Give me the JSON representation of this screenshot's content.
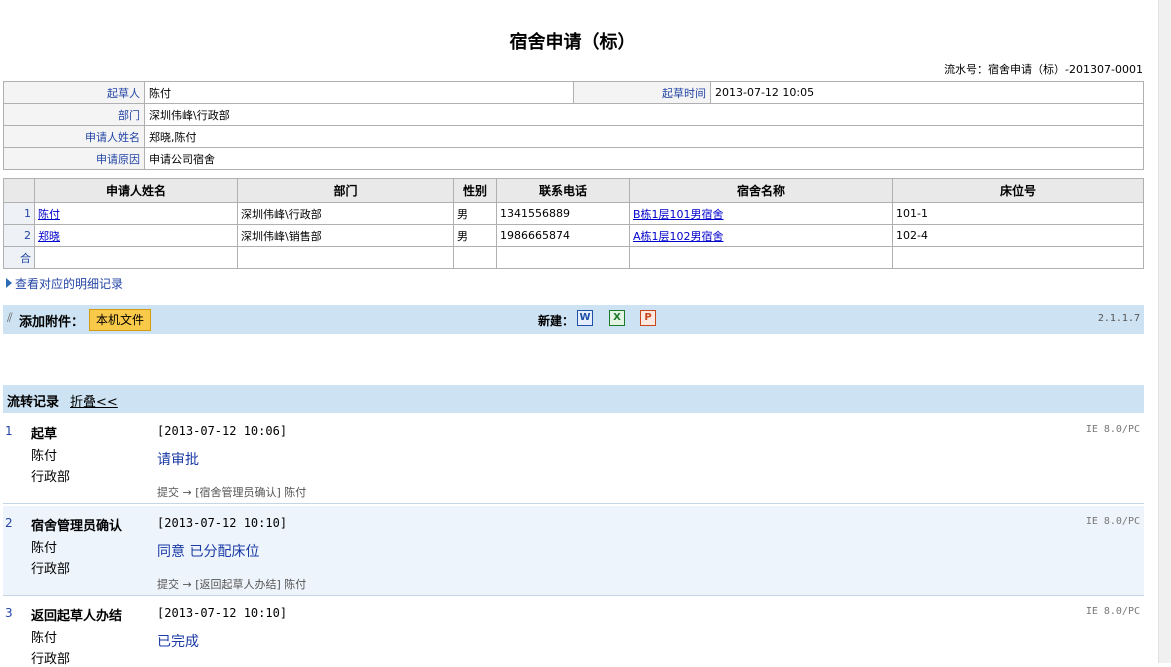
{
  "title": "宿舍申请（标）",
  "serial": "流水号：宿舍申请（标）-201307-0001",
  "info": {
    "drafter_label": "起草人",
    "drafter": "陈付",
    "draft_time_label": "起草时间",
    "draft_time": "2013-07-12 10:05",
    "dept_label": "部门",
    "dept": "深圳伟峰\\行政部",
    "applicant_label": "申请人姓名",
    "applicant": "郑晓,陈付",
    "reason_label": "申请原因",
    "reason": "申请公司宿舍"
  },
  "detail": {
    "headers": [
      "申请人姓名",
      "部门",
      "性别",
      "联系电话",
      "宿舍名称",
      "床位号"
    ],
    "rows": [
      {
        "idx": "1",
        "name": "陈付",
        "dept": "深圳伟峰\\行政部",
        "gender": "男",
        "phone": "1341556889",
        "dorm": "B栋1层101男宿舍",
        "bed": "101-1"
      },
      {
        "idx": "2",
        "name": "郑晓",
        "dept": "深圳伟峰\\销售部",
        "gender": "男",
        "phone": "1986665874",
        "dorm": "A栋1层102男宿舍",
        "bed": "102-4"
      }
    ],
    "sum_label": "合"
  },
  "view_link": "查看对应的明细记录",
  "attach": {
    "label": "添加附件：",
    "local_btn": "本机文件",
    "new_label": "新建：",
    "word_icon": "W",
    "excel_icon": "X",
    "ppt_icon": "P",
    "version": "2.1.1.7"
  },
  "flow": {
    "title": "流转记录",
    "fold": "折叠<<",
    "records": [
      {
        "n": "1",
        "step": "起草",
        "who": "陈付",
        "dept": "行政部",
        "time": "[2013-07-12 10:06]",
        "opinion": "请审批",
        "next": "提交 → [宿舍管理员确认] 陈付",
        "client": "IE 8.0/PC"
      },
      {
        "n": "2",
        "step": "宿舍管理员确认",
        "who": "陈付",
        "dept": "行政部",
        "time": "[2013-07-12 10:10]",
        "opinion": "同意 已分配床位",
        "next": "提交 → [返回起草人办结] 陈付",
        "client": "IE 8.0/PC"
      },
      {
        "n": "3",
        "step": "返回起草人办结",
        "who": "陈付",
        "dept": "行政部",
        "time": "[2013-07-12 10:10]",
        "opinion": "已完成",
        "next": "",
        "client": "IE 8.0/PC"
      }
    ]
  },
  "colors": {
    "bar_bg": "#cde3f3",
    "button": "#f9c94a",
    "link": "#0000cc"
  }
}
